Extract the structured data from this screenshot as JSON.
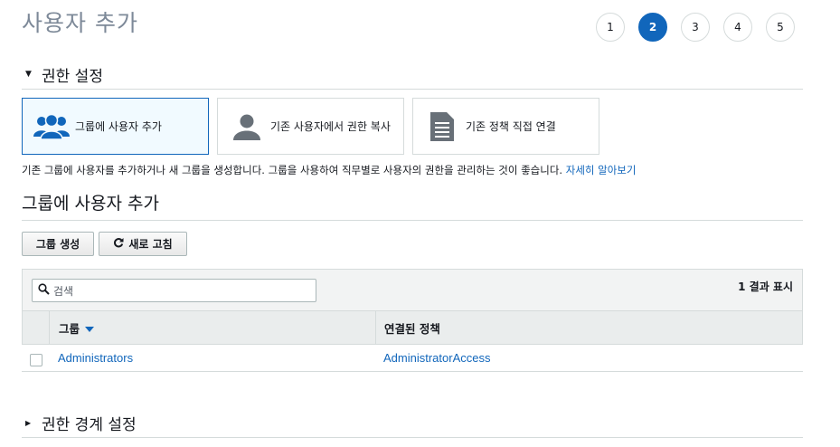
{
  "page": {
    "title": "사용자 추가"
  },
  "steps": [
    {
      "label": "1",
      "active": false
    },
    {
      "label": "2",
      "active": true
    },
    {
      "label": "3",
      "active": false
    },
    {
      "label": "4",
      "active": false
    },
    {
      "label": "5",
      "active": false
    }
  ],
  "permissions": {
    "section_title": "권한 설정",
    "options": [
      {
        "label": "그룹에 사용자 추가",
        "icon": "users-group-icon",
        "selected": true
      },
      {
        "label": "기존 사용자에서 권한 복사",
        "icon": "user-icon",
        "selected": false
      },
      {
        "label": "기존 정책 직접 연결",
        "icon": "document-icon",
        "selected": false
      }
    ],
    "description": "기존 그룹에 사용자를 추가하거나 새 그룹을 생성합니다. 그룹을 사용하여 직무별로 사용자의 권한을 관리하는 것이 좋습니다.",
    "learn_more": "자세히 알아보기"
  },
  "group_section": {
    "title": "그룹에 사용자 추가",
    "create_button": "그룹 생성",
    "refresh_button": "새로 고침",
    "search_placeholder": "검색",
    "result_count": "1 결과 표시",
    "columns": {
      "group": "그룹",
      "policy": "연결된 정책"
    },
    "rows": [
      {
        "group": "Administrators",
        "policy": "AdministratorAccess"
      }
    ]
  },
  "boundary": {
    "section_title": "권한 경계 설정"
  },
  "colors": {
    "accent": "#1166bb",
    "border": "#d5dbdb",
    "selected_bg": "#f1faff"
  }
}
